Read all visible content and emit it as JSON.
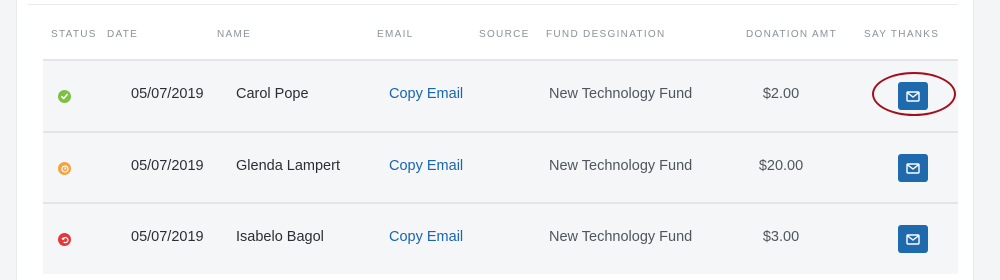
{
  "table": {
    "columns": [
      {
        "key": "status",
        "label": "STATUS"
      },
      {
        "key": "date",
        "label": "DATE"
      },
      {
        "key": "name",
        "label": "NAME"
      },
      {
        "key": "email",
        "label": "EMAIL"
      },
      {
        "key": "source",
        "label": "SOURCE"
      },
      {
        "key": "fund",
        "label": "FUND DESGINATION"
      },
      {
        "key": "amount",
        "label": "DONATION AMT"
      },
      {
        "key": "thanks",
        "label": "SAY THANKS"
      }
    ],
    "rows": [
      {
        "status": "completed",
        "status_icon": "check-circle-icon",
        "status_color": "#7dc142",
        "date": "05/07/2019",
        "name": "Carol Pope",
        "email_link": "Copy Email",
        "source": "",
        "fund": "New Technology Fund",
        "amount": "$2.00",
        "thanks_icon": "envelope-icon"
      },
      {
        "status": "pending",
        "status_icon": "clock-circle-icon",
        "status_color": "#f5a341",
        "date": "05/07/2019",
        "name": "Glenda Lampert",
        "email_link": "Copy Email",
        "source": "",
        "fund": "New Technology Fund",
        "amount": "$20.00",
        "thanks_icon": "envelope-icon"
      },
      {
        "status": "refunded",
        "status_icon": "refund-circle-icon",
        "status_color": "#e23a3a",
        "date": "05/07/2019",
        "name": "Isabelo Bagol",
        "email_link": "Copy Email",
        "source": "",
        "fund": "New Technology Fund",
        "amount": "$3.00",
        "thanks_icon": "envelope-icon"
      }
    ]
  },
  "colors": {
    "accent": "#1f69ad",
    "link": "#1a65b0",
    "highlight": "#a10f1c"
  }
}
